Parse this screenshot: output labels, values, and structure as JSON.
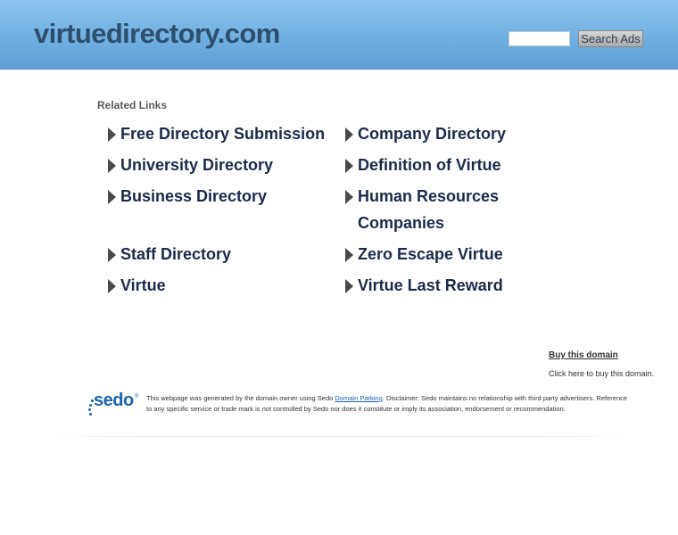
{
  "header": {
    "site_title": "virtuedirectory.com",
    "search_input_value": "",
    "search_button_label": "Search Ads"
  },
  "related": {
    "title": "Related Links",
    "left_links": [
      "Free Directory Submission",
      "University Directory",
      "Business Directory",
      "Staff Directory",
      "Virtue"
    ],
    "right_links": [
      "Company Directory",
      "Definition of Virtue",
      "Human Resources Companies",
      "Zero Escape Virtue",
      "Virtue Last Reward"
    ]
  },
  "buy": {
    "link_label": "Buy this domain",
    "sub_text": "Click here to buy this domain."
  },
  "footer": {
    "logo_text": "sedo",
    "logo_mark": "®",
    "disclaimer_pre": "This webpage was generated by the domain owner using Sedo ",
    "disclaimer_link": "Domain Parking",
    "disclaimer_post": ". Disclaimer: Sedo maintains no relationship with third party advertisers. Reference to any specific service or trade mark is not controlled by Sedo nor does it constitute or imply its association, endorsement or recommendation."
  },
  "icons": {
    "link_bullet": "arrow-right-icon",
    "logo": "sedo-logo"
  },
  "colors": {
    "header_top": "#8cc4ee",
    "header_bottom": "#5f9fd6",
    "title_text": "#2d4f6e",
    "link_text": "#1b2a4a",
    "sedo_blue": "#1a63b0"
  }
}
